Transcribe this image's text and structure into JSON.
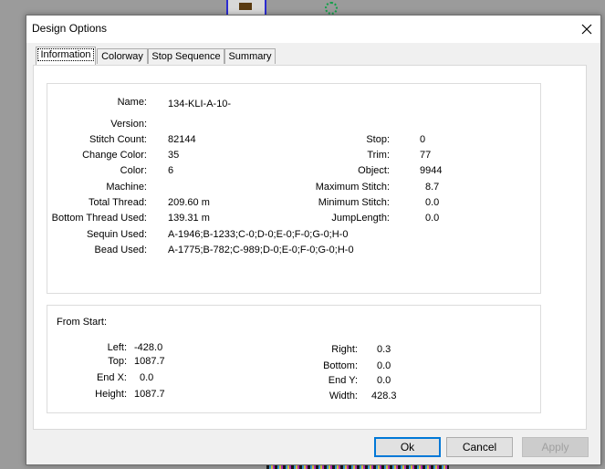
{
  "dialog": {
    "title": "Design Options"
  },
  "tabs": [
    {
      "label": "Information"
    },
    {
      "label": "Colorway"
    },
    {
      "label": "Stop Sequence"
    },
    {
      "label": "Summary"
    }
  ],
  "info": {
    "name": {
      "label": "Name:",
      "value": "134-KLI-A-10-"
    },
    "version": {
      "label": "Version:",
      "value": ""
    },
    "stitch_count": {
      "label": "Stitch Count:",
      "value": "82144"
    },
    "change_color": {
      "label": "Change Color:",
      "value": "35"
    },
    "color": {
      "label": "Color:",
      "value": "6"
    },
    "machine": {
      "label": "Machine:",
      "value": ""
    },
    "total_thread": {
      "label": "Total Thread:",
      "value": "209.60 m"
    },
    "bottom_thread": {
      "label": "Bottom Thread Used:",
      "value": "139.31 m"
    },
    "sequin_used": {
      "label": "Sequin Used:",
      "value": "A-1946;B-1233;C-0;D-0;E-0;F-0;G-0;H-0"
    },
    "bead_used": {
      "label": "Bead Used:",
      "value": "A-1775;B-782;C-989;D-0;E-0;F-0;G-0;H-0"
    },
    "stop": {
      "label": "Stop:",
      "value": "0"
    },
    "trim": {
      "label": "Trim:",
      "value": "77"
    },
    "object": {
      "label": "Object:",
      "value": "9944"
    },
    "max_stitch": {
      "label": "Maximum Stitch:",
      "value": "8.7"
    },
    "min_stitch": {
      "label": "Minimum Stitch:",
      "value": "0.0"
    },
    "jump_length": {
      "label": "JumpLength:",
      "value": "0.0"
    }
  },
  "from_start": {
    "title": "From Start:",
    "left": {
      "label": "Left:",
      "value": "-428.0"
    },
    "top": {
      "label": "Top:",
      "value": "1087.7"
    },
    "end_x": {
      "label": "End X:",
      "value": "0.0"
    },
    "height": {
      "label": "Height:",
      "value": "1087.7"
    },
    "right": {
      "label": "Right:",
      "value": "0.3"
    },
    "bottom": {
      "label": "Bottom:",
      "value": "0.0"
    },
    "end_y": {
      "label": "End Y:",
      "value": "0.0"
    },
    "width": {
      "label": "Width:",
      "value": "428.3"
    }
  },
  "buttons": {
    "ok": "Ok",
    "cancel": "Cancel",
    "apply": "Apply"
  },
  "colors": {
    "focus": "#0078d7",
    "panel_bg": "#ffffff",
    "dialog_bg": "#f0f0f0",
    "desktop_bg": "#9b9b9b"
  }
}
